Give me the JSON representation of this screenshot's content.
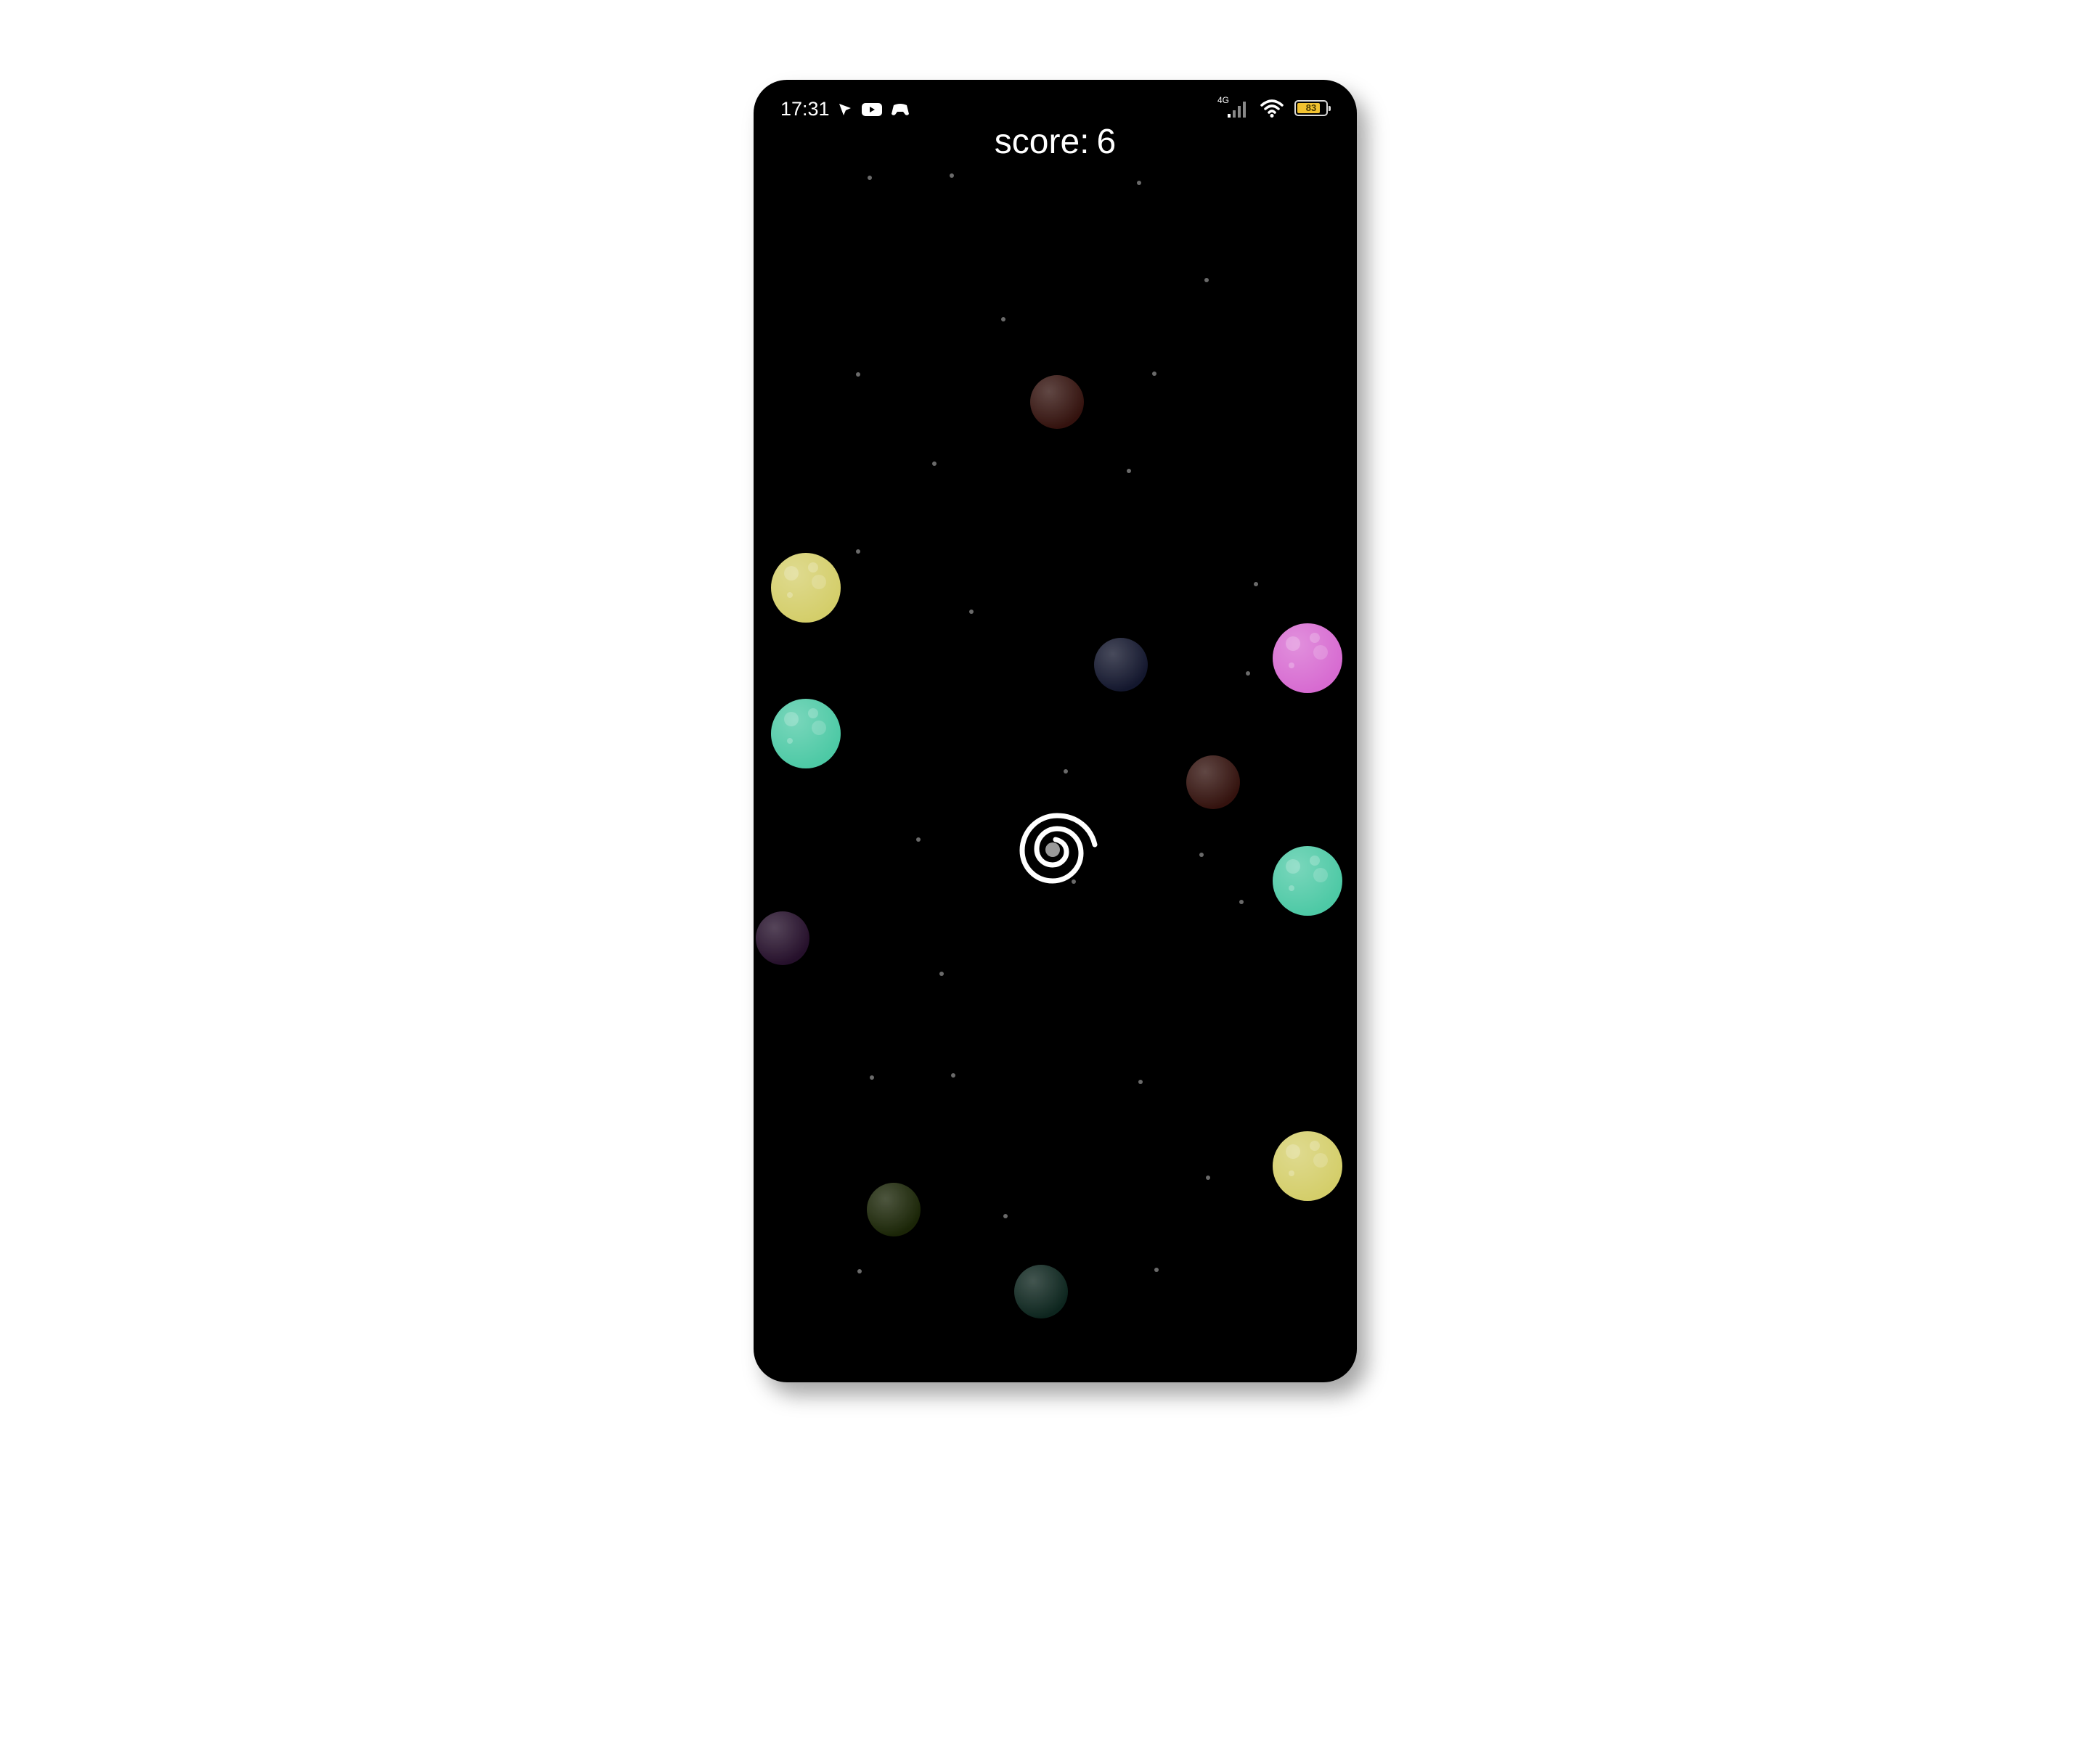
{
  "status_bar": {
    "time": "17:31",
    "network": "4G",
    "battery_level": "83",
    "left_icons": [
      "location-icon",
      "youtube-icon",
      "gamepad-icon"
    ],
    "right_icons": [
      "signal-icon",
      "wifi-icon",
      "battery-icon"
    ]
  },
  "game": {
    "score_label": "score:",
    "score_value": "6",
    "player_icon": "spiral-icon",
    "colors": {
      "background": "#000000",
      "yellow": "#d4ce6a",
      "teal": "#4dc9a5",
      "magenta": "#d76bd1",
      "star": "#6a6a6a"
    }
  }
}
